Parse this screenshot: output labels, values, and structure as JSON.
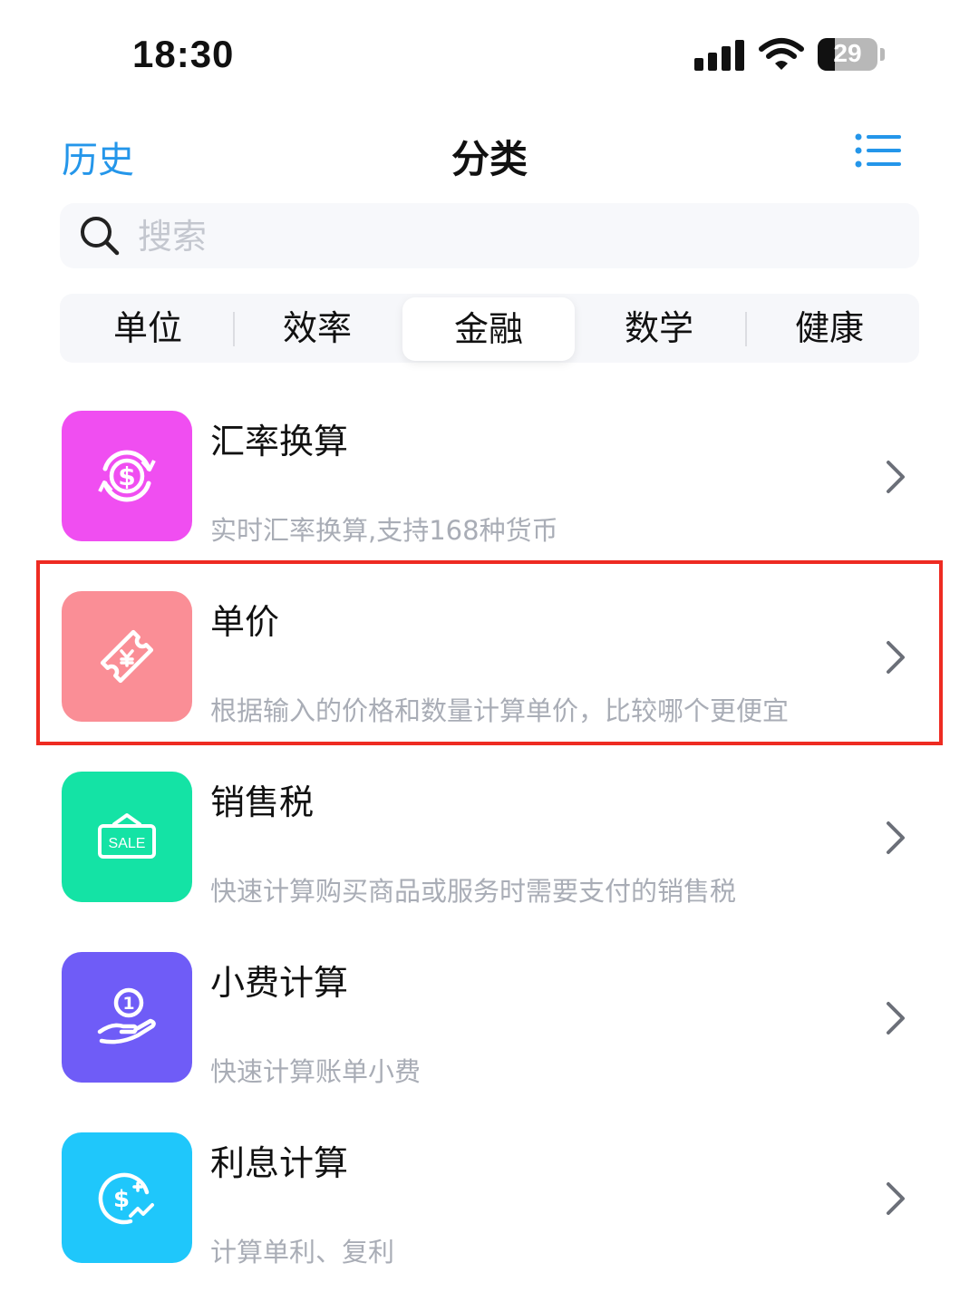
{
  "status_bar": {
    "time": "18:30",
    "battery_percent": "29",
    "battery_level": 0.29
  },
  "nav": {
    "history_label": "历史",
    "title": "分类"
  },
  "search": {
    "placeholder": "搜索"
  },
  "tabs": [
    {
      "label": "单位",
      "active": false
    },
    {
      "label": "效率",
      "active": false
    },
    {
      "label": "金融",
      "active": true
    },
    {
      "label": "数学",
      "active": false
    },
    {
      "label": "健康",
      "active": false
    }
  ],
  "items": [
    {
      "title": "汇率换算",
      "description": "实时汇率换算,支持168种货币",
      "icon": "currency-exchange-icon",
      "color": "#f04ef1"
    },
    {
      "title": "单价",
      "description": "根据输入的价格和数量计算单价，比较哪个更便宜",
      "icon": "price-tag-icon",
      "color": "#fa8e96",
      "highlighted": true
    },
    {
      "title": "销售税",
      "description": "快速计算购买商品或服务时需要支付的销售税",
      "icon": "sale-sign-icon",
      "icon_text": "SALE",
      "color": "#14e3a5"
    },
    {
      "title": "小费计算",
      "description": "快速计算账单小费",
      "icon": "coin-hand-icon",
      "color": "#6f5cf7"
    },
    {
      "title": "利息计算",
      "description": "计算单利、复利",
      "icon": "interest-icon",
      "color": "#1fc7fb"
    }
  ],
  "colors": {
    "accent": "#2496ea",
    "highlight_border": "#ee2b22",
    "desc_text": "#a9adb6"
  }
}
